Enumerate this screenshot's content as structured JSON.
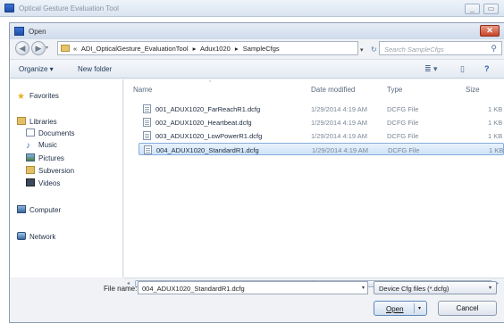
{
  "app": {
    "title": "Optical Gesture Evaluation Tool",
    "minimize_glyph": "_",
    "restore_glyph": "▭"
  },
  "dialog": {
    "title": "Open",
    "close_glyph": "✕"
  },
  "nav": {
    "back_glyph": "◀",
    "forward_glyph": "▶",
    "recent_glyph": "▾"
  },
  "address": {
    "prefix": "«",
    "crumbs": [
      "ADI_OpticalGesture_EvaluationTool",
      "▸",
      "Adux1020",
      "▸",
      "SampleCfgs"
    ],
    "crumb_sep": "▸",
    "drop_glyph": "▾",
    "refresh_glyph": "↻"
  },
  "search": {
    "placeholder": "Search SampleCfgs",
    "icon_glyph": "⚲"
  },
  "toolbar": {
    "organize_label": "Organize ▾",
    "new_folder_label": "New folder",
    "views_glyph": "≣ ▾",
    "preview_glyph": "▯",
    "help_glyph": "?"
  },
  "sidebar": {
    "items": [
      {
        "label": "Favorites",
        "icon": "star-icon"
      },
      {
        "label": "Libraries",
        "icon": "library-icon"
      },
      {
        "label": "Documents",
        "icon": "documents-icon"
      },
      {
        "label": "Music",
        "icon": "music-icon"
      },
      {
        "label": "Pictures",
        "icon": "pictures-icon"
      },
      {
        "label": "Subversion",
        "icon": "folder-icon"
      },
      {
        "label": "Videos",
        "icon": "videos-icon"
      },
      {
        "label": "Computer",
        "icon": "computer-icon"
      },
      {
        "label": "Network",
        "icon": "network-icon"
      }
    ]
  },
  "files": {
    "columns": {
      "name": "Name",
      "date": "Date modified",
      "type": "Type",
      "size": "Size"
    },
    "sort_glyph": "^",
    "rows": [
      {
        "name": "001_ADUX1020_FarReachR1.dcfg",
        "date": "1/29/2014 4:19 AM",
        "type": "DCFG File",
        "size": "1 KB",
        "selected": false
      },
      {
        "name": "002_ADUX1020_Heartbeat.dcfg",
        "date": "1/29/2014 4:19 AM",
        "type": "DCFG File",
        "size": "1 KB",
        "selected": false
      },
      {
        "name": "003_ADUX1020_LowPowerR1.dcfg",
        "date": "1/29/2014 4:19 AM",
        "type": "DCFG File",
        "size": "1 KB",
        "selected": false
      },
      {
        "name": "004_ADUX1020_StandardR1.dcfg",
        "date": "1/29/2014 4:19 AM",
        "type": "DCFG File",
        "size": "1 KB",
        "selected": true
      }
    ]
  },
  "scroll": {
    "left_glyph": "◂",
    "right_glyph": "▸",
    "grip_glyph": "|||"
  },
  "footer": {
    "filename_label": "File name:",
    "filename_value": "004_ADUX1020_StandardR1.dcfg",
    "filename_drop": "▾",
    "filter_value": "Device Cfg files (*.dcfg)",
    "filter_drop": "▾",
    "open_label": "Open",
    "open_drop": "▾",
    "cancel_label": "Cancel"
  }
}
